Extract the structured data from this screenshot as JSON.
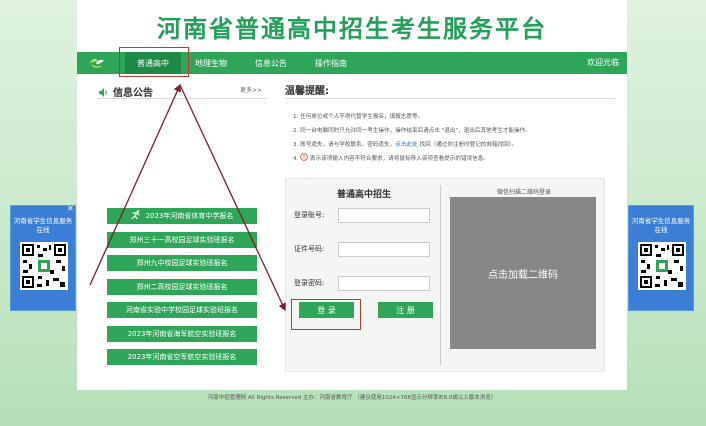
{
  "site": {
    "title": "河南省普通高中招生考生服务平台"
  },
  "nav": {
    "items": [
      "普通高中",
      "地理生物",
      "信息公告",
      "操作指南"
    ],
    "welcome": "欢迎光临"
  },
  "notice": {
    "title": "信息公告",
    "more": "更多>>",
    "icon": "speaker-icon",
    "buttons": [
      "2023年河南省体育中学报名",
      "郑州三十一高校园足球实验班报名",
      "郑州九中校园足球实验班报名",
      "郑州二高校园足球实验班报名",
      "河南省实验中学校园足球实验班报名",
      "2023年河南省海军航空实验班报名",
      "2023年河南省空军航空实验班报名"
    ]
  },
  "tips": {
    "title": "温馨提醒:",
    "items": [
      {
        "pre": "1. 任何单位或个人不得代替学生报名，填报志愿等。",
        "link": "",
        "post": ""
      },
      {
        "pre": "2. 同一台电脑同时只允许同一考生操作，操作结束后请点击 \"退出\"，退出后其他考生才能操作。",
        "link": "",
        "post": ""
      },
      {
        "pre": "3. 账号遗失，请与学校联系。密码遗失，",
        "link": "点击此处",
        "post": " 找回（通过你注册时登记的邮箱找回）。"
      },
      {
        "pre": "4. ",
        "link": "",
        "post": " 表示该项输入内容不符合要求，请将鼠标移入该项查看提示的错误信息。"
      }
    ],
    "colors": {
      "link": "#1a73e8",
      "warn": "#d9342b"
    }
  },
  "login": {
    "title": "普通高中招生",
    "fields": [
      {
        "label": "登录账号:",
        "value": "",
        "placeholder": ""
      },
      {
        "label": "证件号码:",
        "value": "",
        "placeholder": ""
      },
      {
        "label": "登录密码:",
        "value": "",
        "placeholder": ""
      }
    ],
    "login_btn": "登 录",
    "register_btn": "注 册",
    "qr_title": "微信扫描二维码登录",
    "qr_load": "点击加载二维码"
  },
  "side": {
    "text": "河南省学生信息服务在线",
    "close": "✕"
  },
  "footer": {
    "text": "河南中招管理网 All Rights Reserved 主办：河南省教育厅 （建议使用1024×768显示分辨率IE8.0或以上版本浏览）"
  },
  "colors": {
    "brand": "#2fa55a",
    "brand_dark": "#1e8a47",
    "title": "#22a05a",
    "side": "#3a7fd5",
    "annotation": "#c0392b"
  }
}
